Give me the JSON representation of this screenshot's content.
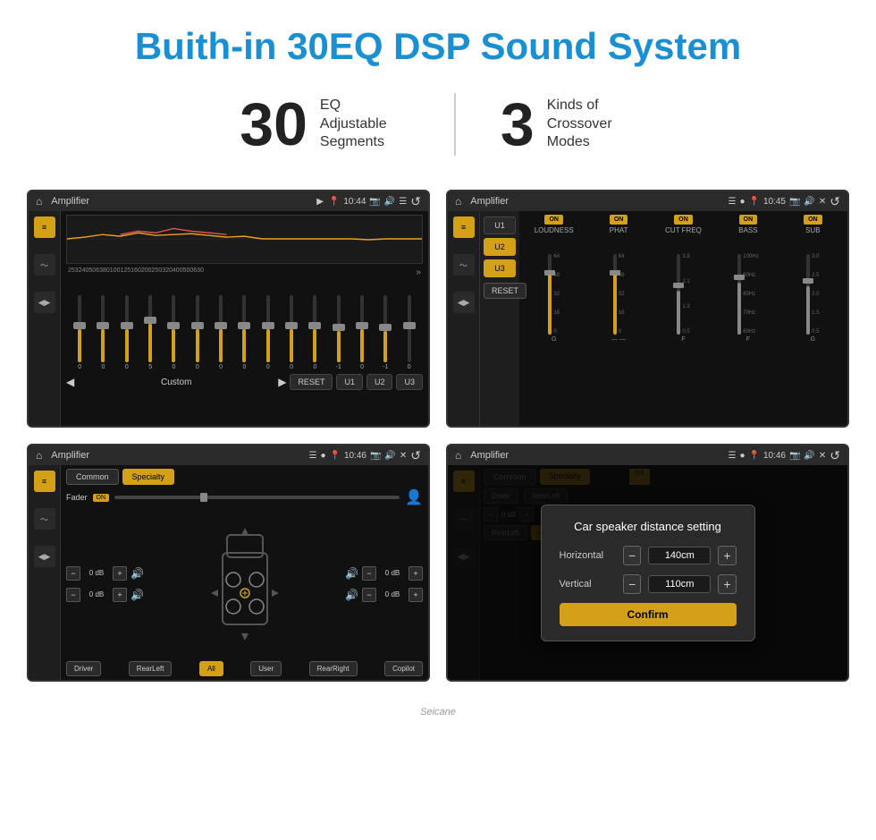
{
  "header": {
    "title": "Buith-in 30EQ DSP Sound System"
  },
  "stats": [
    {
      "number": "30",
      "label": "EQ Adjustable\nSegments"
    },
    {
      "number": "3",
      "label": "Kinds of\nCrossover Modes"
    }
  ],
  "screen1": {
    "statusbar": {
      "title": "Amplifier",
      "time": "10:44"
    },
    "eq_labels": [
      "25",
      "32",
      "40",
      "50",
      "63",
      "80",
      "100",
      "125",
      "160",
      "200",
      "250",
      "320",
      "400",
      "500",
      "630"
    ],
    "eq_values": [
      "0",
      "0",
      "0",
      "5",
      "0",
      "0",
      "0",
      "0",
      "0",
      "0",
      "0",
      "-1",
      "0",
      "-1"
    ],
    "nav": {
      "label": "Custom",
      "reset": "RESET",
      "u1": "U1",
      "u2": "U2",
      "u3": "U3"
    }
  },
  "screen2": {
    "statusbar": {
      "title": "Amplifier",
      "time": "10:45"
    },
    "presets": [
      "U1",
      "U2",
      "U3"
    ],
    "channels": [
      {
        "name": "LOUDNESS",
        "toggle": "ON"
      },
      {
        "name": "PHAT",
        "toggle": "ON"
      },
      {
        "name": "CUT FREQ",
        "toggle": "ON"
      },
      {
        "name": "BASS",
        "toggle": "ON"
      },
      {
        "name": "SUB",
        "toggle": "ON"
      }
    ],
    "reset": "RESET"
  },
  "screen3": {
    "statusbar": {
      "title": "Amplifier",
      "time": "10:46"
    },
    "tabs": [
      "Common",
      "Specialty"
    ],
    "fader_label": "Fader",
    "fader_on": "ON",
    "speaker_rows": [
      {
        "value": "0 dB"
      },
      {
        "value": "0 dB"
      }
    ],
    "speaker_rows_right": [
      {
        "value": "0 dB"
      },
      {
        "value": "0 dB"
      }
    ],
    "bottom_buttons": [
      "Driver",
      "RearLeft",
      "All",
      "User",
      "RearRight",
      "Copilot"
    ]
  },
  "screen4": {
    "statusbar": {
      "title": "Amplifier",
      "time": "10:46"
    },
    "dialog": {
      "title": "Car speaker distance setting",
      "horizontal_label": "Horizontal",
      "horizontal_value": "140cm",
      "vertical_label": "Vertical",
      "vertical_value": "110cm",
      "confirm_label": "Confirm"
    }
  },
  "watermark": "Seicane"
}
